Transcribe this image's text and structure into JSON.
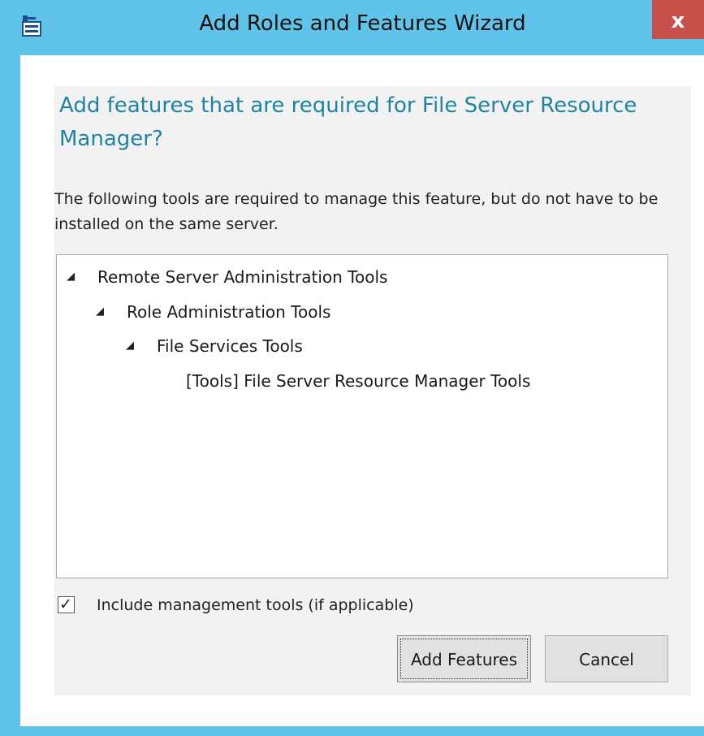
{
  "window": {
    "title": "Add Roles and Features Wizard",
    "close_label": "x",
    "icon": "wizard-app-icon",
    "accent_color": "#5fc3ea",
    "close_color": "#c7504b"
  },
  "dialog": {
    "heading": "Add features that are required for File Server Resource Manager?",
    "heading_color": "#1e83a6",
    "description": "The following tools are required to manage this feature, but do not have to be installed on the same server.",
    "tree": [
      {
        "label": "Remote Server Administration Tools",
        "expanded": true,
        "icon": "expanded-triangle-icon"
      },
      {
        "label": "Role Administration Tools",
        "expanded": true,
        "icon": "expanded-triangle-icon"
      },
      {
        "label": "File Services Tools",
        "expanded": true,
        "icon": "expanded-triangle-icon"
      },
      {
        "label": "[Tools] File Server Resource Manager Tools",
        "expanded": null,
        "icon": null
      }
    ],
    "include_tools": {
      "label": "Include management tools (if applicable)",
      "checked": true,
      "check_glyph": "✓"
    },
    "buttons": {
      "add_features": "Add Features",
      "cancel": "Cancel"
    }
  }
}
